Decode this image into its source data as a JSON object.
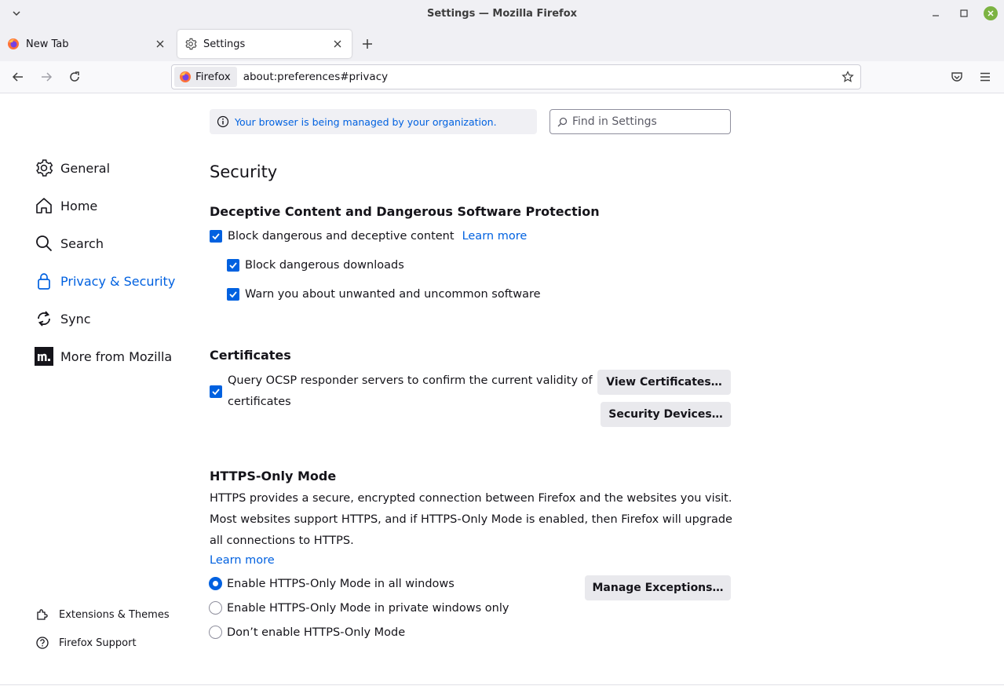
{
  "window": {
    "title": "Settings — Mozilla Firefox"
  },
  "tabs": [
    {
      "label": "New Tab"
    },
    {
      "label": "Settings"
    }
  ],
  "navbar": {
    "identity_label": "Firefox",
    "url": "about:preferences#privacy"
  },
  "managed_notice": "Your browser is being managed by your organization.",
  "find": {
    "placeholder": "Find in Settings"
  },
  "sidebar": {
    "items": [
      {
        "label": "General",
        "icon": "gear-icon"
      },
      {
        "label": "Home",
        "icon": "home-icon"
      },
      {
        "label": "Search",
        "icon": "search-icon"
      },
      {
        "label": "Privacy & Security",
        "icon": "lock-icon"
      },
      {
        "label": "Sync",
        "icon": "sync-icon"
      },
      {
        "label": "More from Mozilla",
        "icon": "mozilla-icon"
      }
    ],
    "footer": [
      {
        "label": "Extensions & Themes",
        "icon": "puzzle-icon"
      },
      {
        "label": "Firefox Support",
        "icon": "help-icon"
      }
    ]
  },
  "security": {
    "heading": "Security",
    "deceptive": {
      "heading": "Deceptive Content and Dangerous Software Protection",
      "block_deceptive": "Block dangerous and deceptive content",
      "learn_more": "Learn more",
      "block_downloads": "Block dangerous downloads",
      "warn_unwanted": "Warn you about unwanted and uncommon software"
    },
    "certificates": {
      "heading": "Certificates",
      "ocsp_line1": "Query OCSP responder servers to confirm the current validity of",
      "ocsp_line2": "certificates",
      "view_button": "View Certificates…",
      "devices_button": "Security Devices…"
    },
    "https_only": {
      "heading": "HTTPS-Only Mode",
      "description": "HTTPS provides a secure, encrypted connection between Firefox and the websites you visit. Most websites support HTTPS, and if HTTPS-Only Mode is enabled, then Firefox will upgrade all connections to HTTPS.",
      "learn_more": "Learn more",
      "options": [
        {
          "label": "Enable HTTPS-Only Mode in all windows",
          "selected": true
        },
        {
          "label": "Enable HTTPS-Only Mode in private windows only",
          "selected": false
        },
        {
          "label": "Don’t enable HTTPS-Only Mode",
          "selected": false
        }
      ],
      "exceptions_button": "Manage Exceptions…"
    }
  },
  "colors": {
    "accent": "#0061e0",
    "window_close": "#7cb342"
  }
}
